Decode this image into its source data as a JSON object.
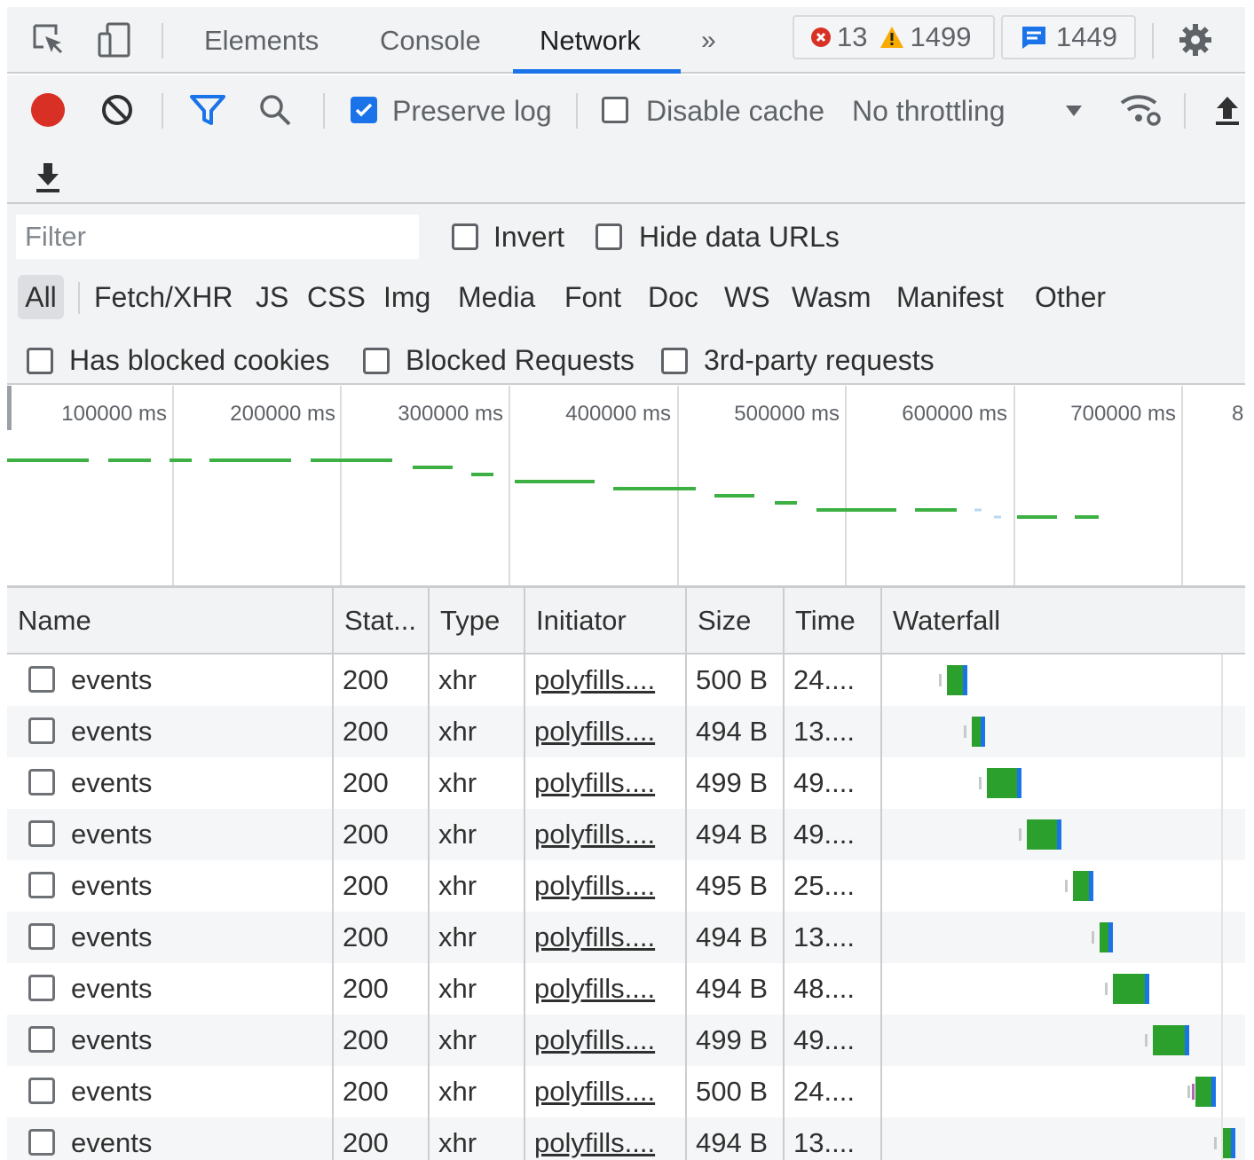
{
  "tabs": {
    "elements": "Elements",
    "console": "Console",
    "network": "Network",
    "more": "»"
  },
  "counters": {
    "errors": "13",
    "warnings": "1499",
    "messages": "1449"
  },
  "toolbar": {
    "preserve_log": "Preserve log",
    "preserve_log_checked": true,
    "disable_cache": "Disable cache",
    "disable_cache_checked": false,
    "throttling": "No throttling"
  },
  "filter": {
    "placeholder": "Filter",
    "invert": "Invert",
    "hide_data_urls": "Hide data URLs",
    "types": [
      "All",
      "Fetch/XHR",
      "JS",
      "CSS",
      "Img",
      "Media",
      "Font",
      "Doc",
      "WS",
      "Wasm",
      "Manifest",
      "Other"
    ],
    "selected_type": "All",
    "has_blocked_cookies": "Has blocked cookies",
    "blocked_requests": "Blocked Requests",
    "third_party": "3rd-party requests"
  },
  "overview": {
    "ticks": [
      "100000 ms",
      "200000 ms",
      "300000 ms",
      "400000 ms",
      "500000 ms",
      "600000 ms",
      "700000 ms",
      "8"
    ]
  },
  "table": {
    "columns": {
      "name": "Name",
      "status": "Stat...",
      "type": "Type",
      "initiator": "Initiator",
      "size": "Size",
      "time": "Time",
      "waterfall": "Waterfall"
    },
    "rows": [
      {
        "name": "events",
        "status": "200",
        "type": "xhr",
        "initiator": "polyfills....",
        "size": "500 B",
        "time": "24...."
      },
      {
        "name": "events",
        "status": "200",
        "type": "xhr",
        "initiator": "polyfills....",
        "size": "494 B",
        "time": "13...."
      },
      {
        "name": "events",
        "status": "200",
        "type": "xhr",
        "initiator": "polyfills....",
        "size": "499 B",
        "time": "49...."
      },
      {
        "name": "events",
        "status": "200",
        "type": "xhr",
        "initiator": "polyfills....",
        "size": "494 B",
        "time": "49...."
      },
      {
        "name": "events",
        "status": "200",
        "type": "xhr",
        "initiator": "polyfills....",
        "size": "495 B",
        "time": "25...."
      },
      {
        "name": "events",
        "status": "200",
        "type": "xhr",
        "initiator": "polyfills....",
        "size": "494 B",
        "time": "13...."
      },
      {
        "name": "events",
        "status": "200",
        "type": "xhr",
        "initiator": "polyfills....",
        "size": "494 B",
        "time": "48...."
      },
      {
        "name": "events",
        "status": "200",
        "type": "xhr",
        "initiator": "polyfills....",
        "size": "499 B",
        "time": "49...."
      },
      {
        "name": "events",
        "status": "200",
        "type": "xhr",
        "initiator": "polyfills....",
        "size": "500 B",
        "time": "24...."
      },
      {
        "name": "events",
        "status": "200",
        "type": "xhr",
        "initiator": "polyfills....",
        "size": "494 B",
        "time": "13...."
      }
    ]
  },
  "colors": {
    "accent": "#1a73e8",
    "record": "#d93025",
    "error": "#d93025",
    "warning": "#f9ab00",
    "waterfall_wait": "#2ca02c",
    "waterfall_receive": "#1a73e8"
  }
}
